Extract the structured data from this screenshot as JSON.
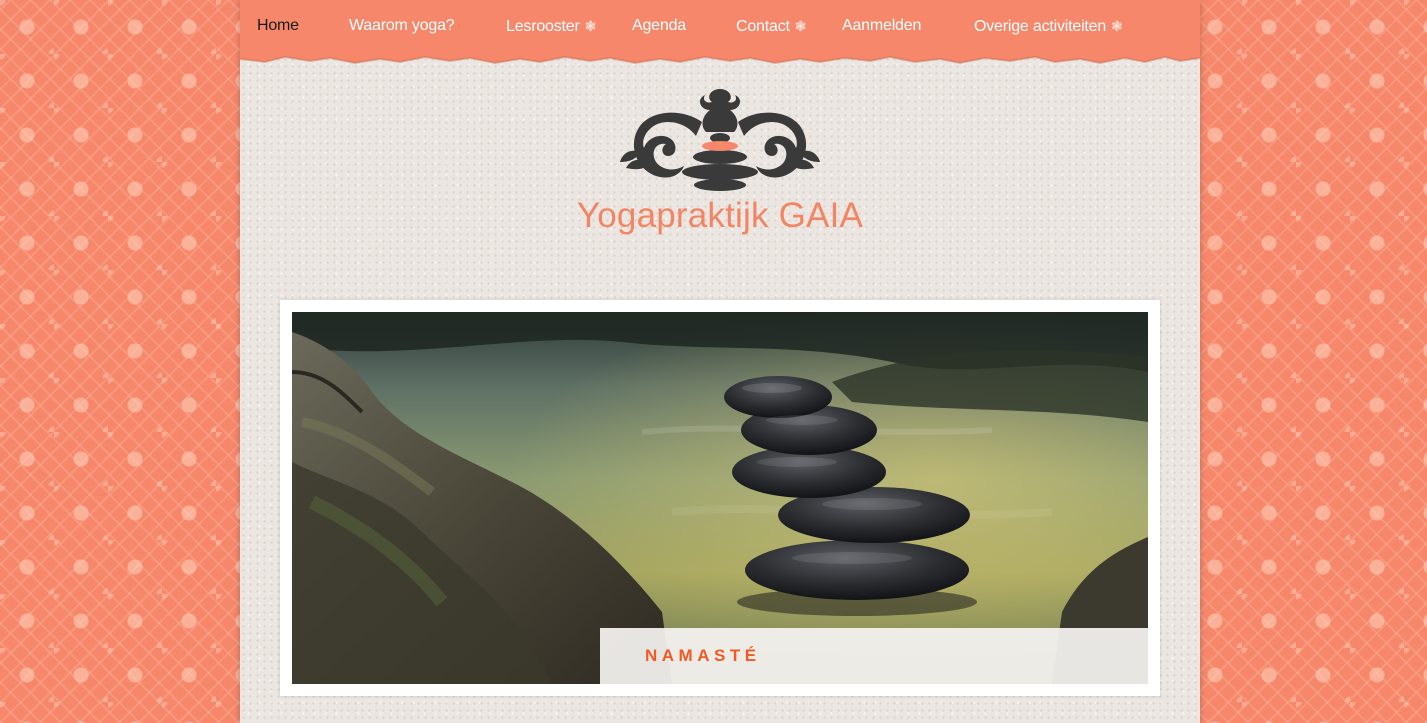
{
  "nav": {
    "items": [
      {
        "label": "Home",
        "active": true
      },
      {
        "label": "Waarom yoga?",
        "active": false
      },
      {
        "label": "Lesrooster",
        "has_submenu": true
      },
      {
        "label": "Agenda",
        "active": false
      },
      {
        "label": "Contact",
        "has_submenu": true
      },
      {
        "label": "Aanmelden",
        "active": false
      },
      {
        "label": "Overige activiteiten",
        "has_submenu": true
      }
    ],
    "submenu_glyph": "❃"
  },
  "header": {
    "site_title": "Yogapraktijk GAIA",
    "logo_icon": "stacked-stones-ornament-icon"
  },
  "slider": {
    "caption": "NAMASTÉ",
    "image": "stacked-stones-river-photo"
  },
  "colors": {
    "accent": "#f6876a",
    "title": "#f28563",
    "caption": "#f15a24",
    "paper": "#ebe6e1"
  }
}
